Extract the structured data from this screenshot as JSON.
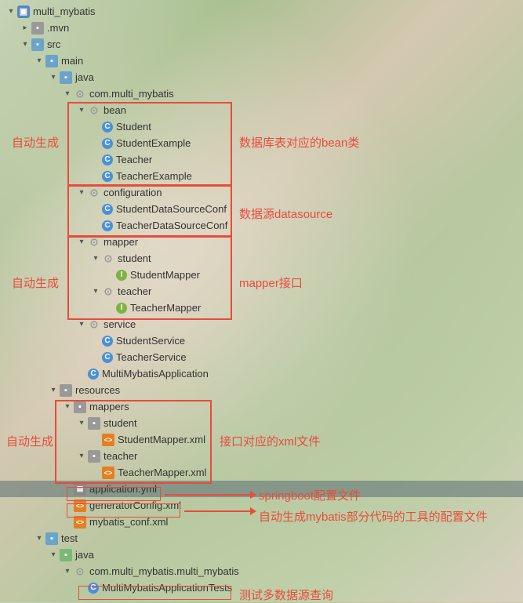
{
  "tree": {
    "root": "multi_mybatis",
    "mvn": ".mvn",
    "src": "src",
    "main": "main",
    "java": "java",
    "package": "com.multi_mybatis",
    "bean": "bean",
    "bean_items": [
      "Student",
      "StudentExample",
      "Teacher",
      "TeacherExample"
    ],
    "configuration": "configuration",
    "configuration_items": [
      "StudentDataSourceConf",
      "TeacherDataSourceConf"
    ],
    "mapper": "mapper",
    "mapper_student": "student",
    "mapper_student_item": "StudentMapper",
    "mapper_teacher": "teacher",
    "mapper_teacher_item": "TeacherMapper",
    "service": "service",
    "service_items": [
      "StudentService",
      "TeacherService"
    ],
    "app_class": "MultiMybatisApplication",
    "resources": "resources",
    "mappers": "mappers",
    "mappers_student": "student",
    "mappers_student_xml": "StudentMapper.xml",
    "mappers_teacher": "teacher",
    "mappers_teacher_xml": "TeacherMapper.xml",
    "app_yml": "application.yml",
    "gen_xml": "generatorConfig.xml",
    "mybatis_xml": "mybatis_conf.xml",
    "test": "test",
    "test_java": "java",
    "test_package": "com.multi_mybatis.multi_mybatis",
    "test_class": "MultiMybatisApplicationTests"
  },
  "annotations": {
    "auto_gen": "自动生成",
    "bean_desc": "数据库表对应的bean类",
    "datasource": "数据源datasource",
    "mapper_iface": "mapper接口",
    "xml_desc": "接口对应的xml文件",
    "springboot": "springboot配置文件",
    "gen_tool": "自动生成mybatis部分代码的工具的配置文件",
    "test_desc": "测试多数据源查询"
  }
}
